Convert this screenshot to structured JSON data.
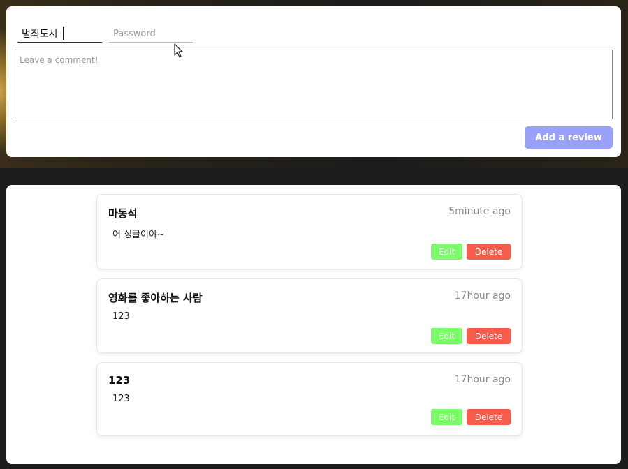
{
  "form": {
    "name_value": "범죄도시",
    "password_placeholder": "Password",
    "comment_placeholder": "Leave a comment!",
    "submit_label": "Add a review"
  },
  "reviews": [
    {
      "author": "마동석",
      "time": "5minute ago",
      "content": "어 싱글이야~",
      "edit_label": "Edit",
      "delete_label": "Delete"
    },
    {
      "author": "영화를 좋아하는 사람",
      "time": "17hour ago",
      "content": "123",
      "edit_label": "Edit",
      "delete_label": "Delete"
    },
    {
      "author": "123",
      "time": "17hour ago",
      "content": "123",
      "edit_label": "Edit",
      "delete_label": "Delete"
    }
  ],
  "colors": {
    "submit": "#9aa1fb",
    "edit": "#7bfb6a",
    "delete": "#f65c4c"
  },
  "icons": {
    "pointer": "mouse-cursor-icon"
  }
}
